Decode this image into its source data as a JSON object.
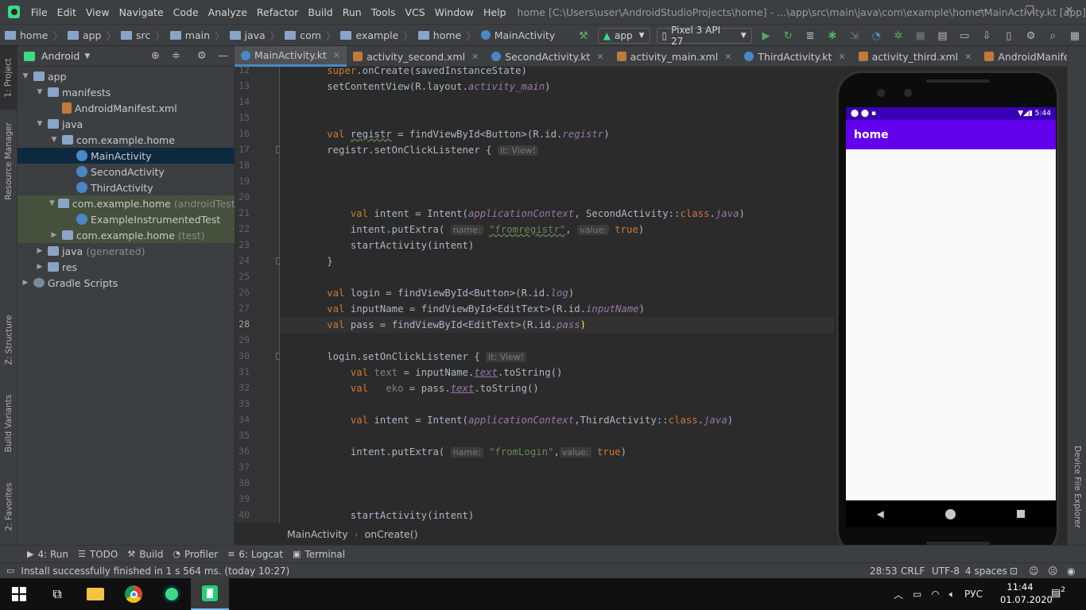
{
  "menu": {
    "items": [
      "File",
      "Edit",
      "View",
      "Navigate",
      "Code",
      "Analyze",
      "Refactor",
      "Build",
      "Run",
      "Tools",
      "VCS",
      "Window",
      "Help"
    ],
    "title": "home [C:\\Users\\user\\AndroidStudioProjects\\home] - ...\\app\\src\\main\\java\\com\\example\\home\\MainActivity.kt [app]"
  },
  "breadcrumb": [
    "home",
    "app",
    "src",
    "main",
    "java",
    "com",
    "example",
    "home",
    "MainActivity"
  ],
  "toolbar": {
    "config": "app",
    "device": "Pixel 3 API 27"
  },
  "project": {
    "view": "Android",
    "tree": [
      {
        "label": "app",
        "indent": 0,
        "arrow": "▼",
        "icon": "folder"
      },
      {
        "label": "manifests",
        "indent": 1,
        "arrow": "▼",
        "icon": "folder"
      },
      {
        "label": "AndroidManifest.xml",
        "indent": 2,
        "arrow": "",
        "icon": "file"
      },
      {
        "label": "java",
        "indent": 1,
        "arrow": "▼",
        "icon": "folder"
      },
      {
        "label": "com.example.home",
        "indent": 2,
        "arrow": "▼",
        "icon": "folder"
      },
      {
        "label": "MainActivity",
        "indent": 3,
        "arrow": "",
        "icon": "kt",
        "sel": true
      },
      {
        "label": "SecondActivity",
        "indent": 3,
        "arrow": "",
        "icon": "kt"
      },
      {
        "label": "ThirdActivity",
        "indent": 3,
        "arrow": "",
        "icon": "kt"
      },
      {
        "label": "com.example.home",
        "note": "(androidTest)",
        "indent": 2,
        "arrow": "▼",
        "icon": "folder",
        "test": true
      },
      {
        "label": "ExampleInstrumentedTest",
        "indent": 3,
        "arrow": "",
        "icon": "kt",
        "test": true
      },
      {
        "label": "com.example.home",
        "note": "(test)",
        "indent": 2,
        "arrow": "▶",
        "icon": "folder",
        "test": true
      },
      {
        "label": "java",
        "note": "(generated)",
        "indent": 1,
        "arrow": "▶",
        "icon": "folder"
      },
      {
        "label": "res",
        "indent": 1,
        "arrow": "▶",
        "icon": "folder"
      },
      {
        "label": "Gradle Scripts",
        "indent": 0,
        "arrow": "▶",
        "icon": "gradle"
      }
    ]
  },
  "left_strip": [
    "1: Project",
    "Resource Manager",
    "Z: Structure",
    "Build Variants",
    "2: Favorites"
  ],
  "tabs": [
    {
      "label": "MainActivity.kt",
      "type": "kt",
      "active": true
    },
    {
      "label": "activity_second.xml",
      "type": "xml"
    },
    {
      "label": "SecondActivity.kt",
      "type": "kt"
    },
    {
      "label": "activity_main.xml",
      "type": "xml"
    },
    {
      "label": "ThirdActivity.kt",
      "type": "kt"
    },
    {
      "label": "activity_third.xml",
      "type": "xml"
    },
    {
      "label": "AndroidManifest.xml",
      "type": "xml"
    }
  ],
  "code": {
    "line_numbers": [
      "12",
      "13",
      "14",
      "15",
      "16",
      "17",
      "18",
      "19",
      "20",
      "21",
      "22",
      "23",
      "24",
      "25",
      "26",
      "27",
      "28",
      "29",
      "30",
      "31",
      "32",
      "33",
      "34",
      "35",
      "36",
      "37",
      "38",
      "39",
      "40"
    ],
    "t": {
      "super": "super",
      ".onCreate": ".onCreate(savedInstanceState)",
      "scv": "setContentView(R.layout.",
      "am": "activity_main",
      ")": ")",
      "val": "val",
      "registr": "registr",
      "fvb_btn": " = findViewById<Button>(R.id.",
      "r_registr": "registr",
      "reg_click": "registr.setOnClickListener { ",
      "hint_view": "it: View!",
      "intent": "intent",
      " = Intent(": " = Intent(",
      "ac": "applicationContext",
      "sa": ", SecondActivity::",
      "class": "class",
      ".": ".",
      "java": "java",
      "pe": "intent.putExtra( ",
      "hname": "name:",
      "s_fromregistr": "\"fromregistr\"",
      "comma": ", ",
      "hvalue": "value:",
      "true": "true",
      "start": "startActivity(intent)",
      "close": "}",
      "login": "login",
      "log": "log",
      "inputName": "inputName",
      "fvb_et": " = findViewById<EditText>(R.id.",
      "pass": "pass",
      "login_click": "login.setOnClickListener { ",
      "text": "text",
      " = inputName.": " = inputName.",
      ".toString()": ".toString()",
      "eko": "  eko",
      " = pass.": " = pass.",
      "ta": ",ThirdActivity::",
      "s_fromLogin": "\"fromLogin\"",
      "comma2": ","
    }
  },
  "editor_breadcrumb": {
    "a": "MainActivity",
    "b": "onCreate()"
  },
  "emulator": {
    "time": "5:44",
    "app_title": "home"
  },
  "toolwindows": [
    {
      "label": "4: Run",
      "icon": "▶"
    },
    {
      "label": "TODO",
      "icon": "☰"
    },
    {
      "label": "Build",
      "icon": "⚒"
    },
    {
      "label": "Profiler",
      "icon": "◔"
    },
    {
      "label": "6: Logcat",
      "icon": "≡"
    },
    {
      "label": "Terminal",
      "icon": "▣"
    }
  ],
  "right_strip": [
    "Device File Explorer"
  ],
  "status": {
    "message": "Install successfully finished in 1 s 564 ms. (today 10:27)",
    "pos": "28:53",
    "eol": "CRLF",
    "enc": "UTF-8",
    "indent": "4 spaces"
  },
  "taskbar": {
    "lang": "РУС",
    "time": "11:44",
    "date": "01.07.2020",
    "notif": "2"
  },
  "colors": {
    "accent": "#4a88c7",
    "appbar": "#6200ee",
    "statusbar": "#3700b3",
    "keyword": "#cc7832",
    "string": "#6a8759",
    "field": "#9876aa"
  }
}
